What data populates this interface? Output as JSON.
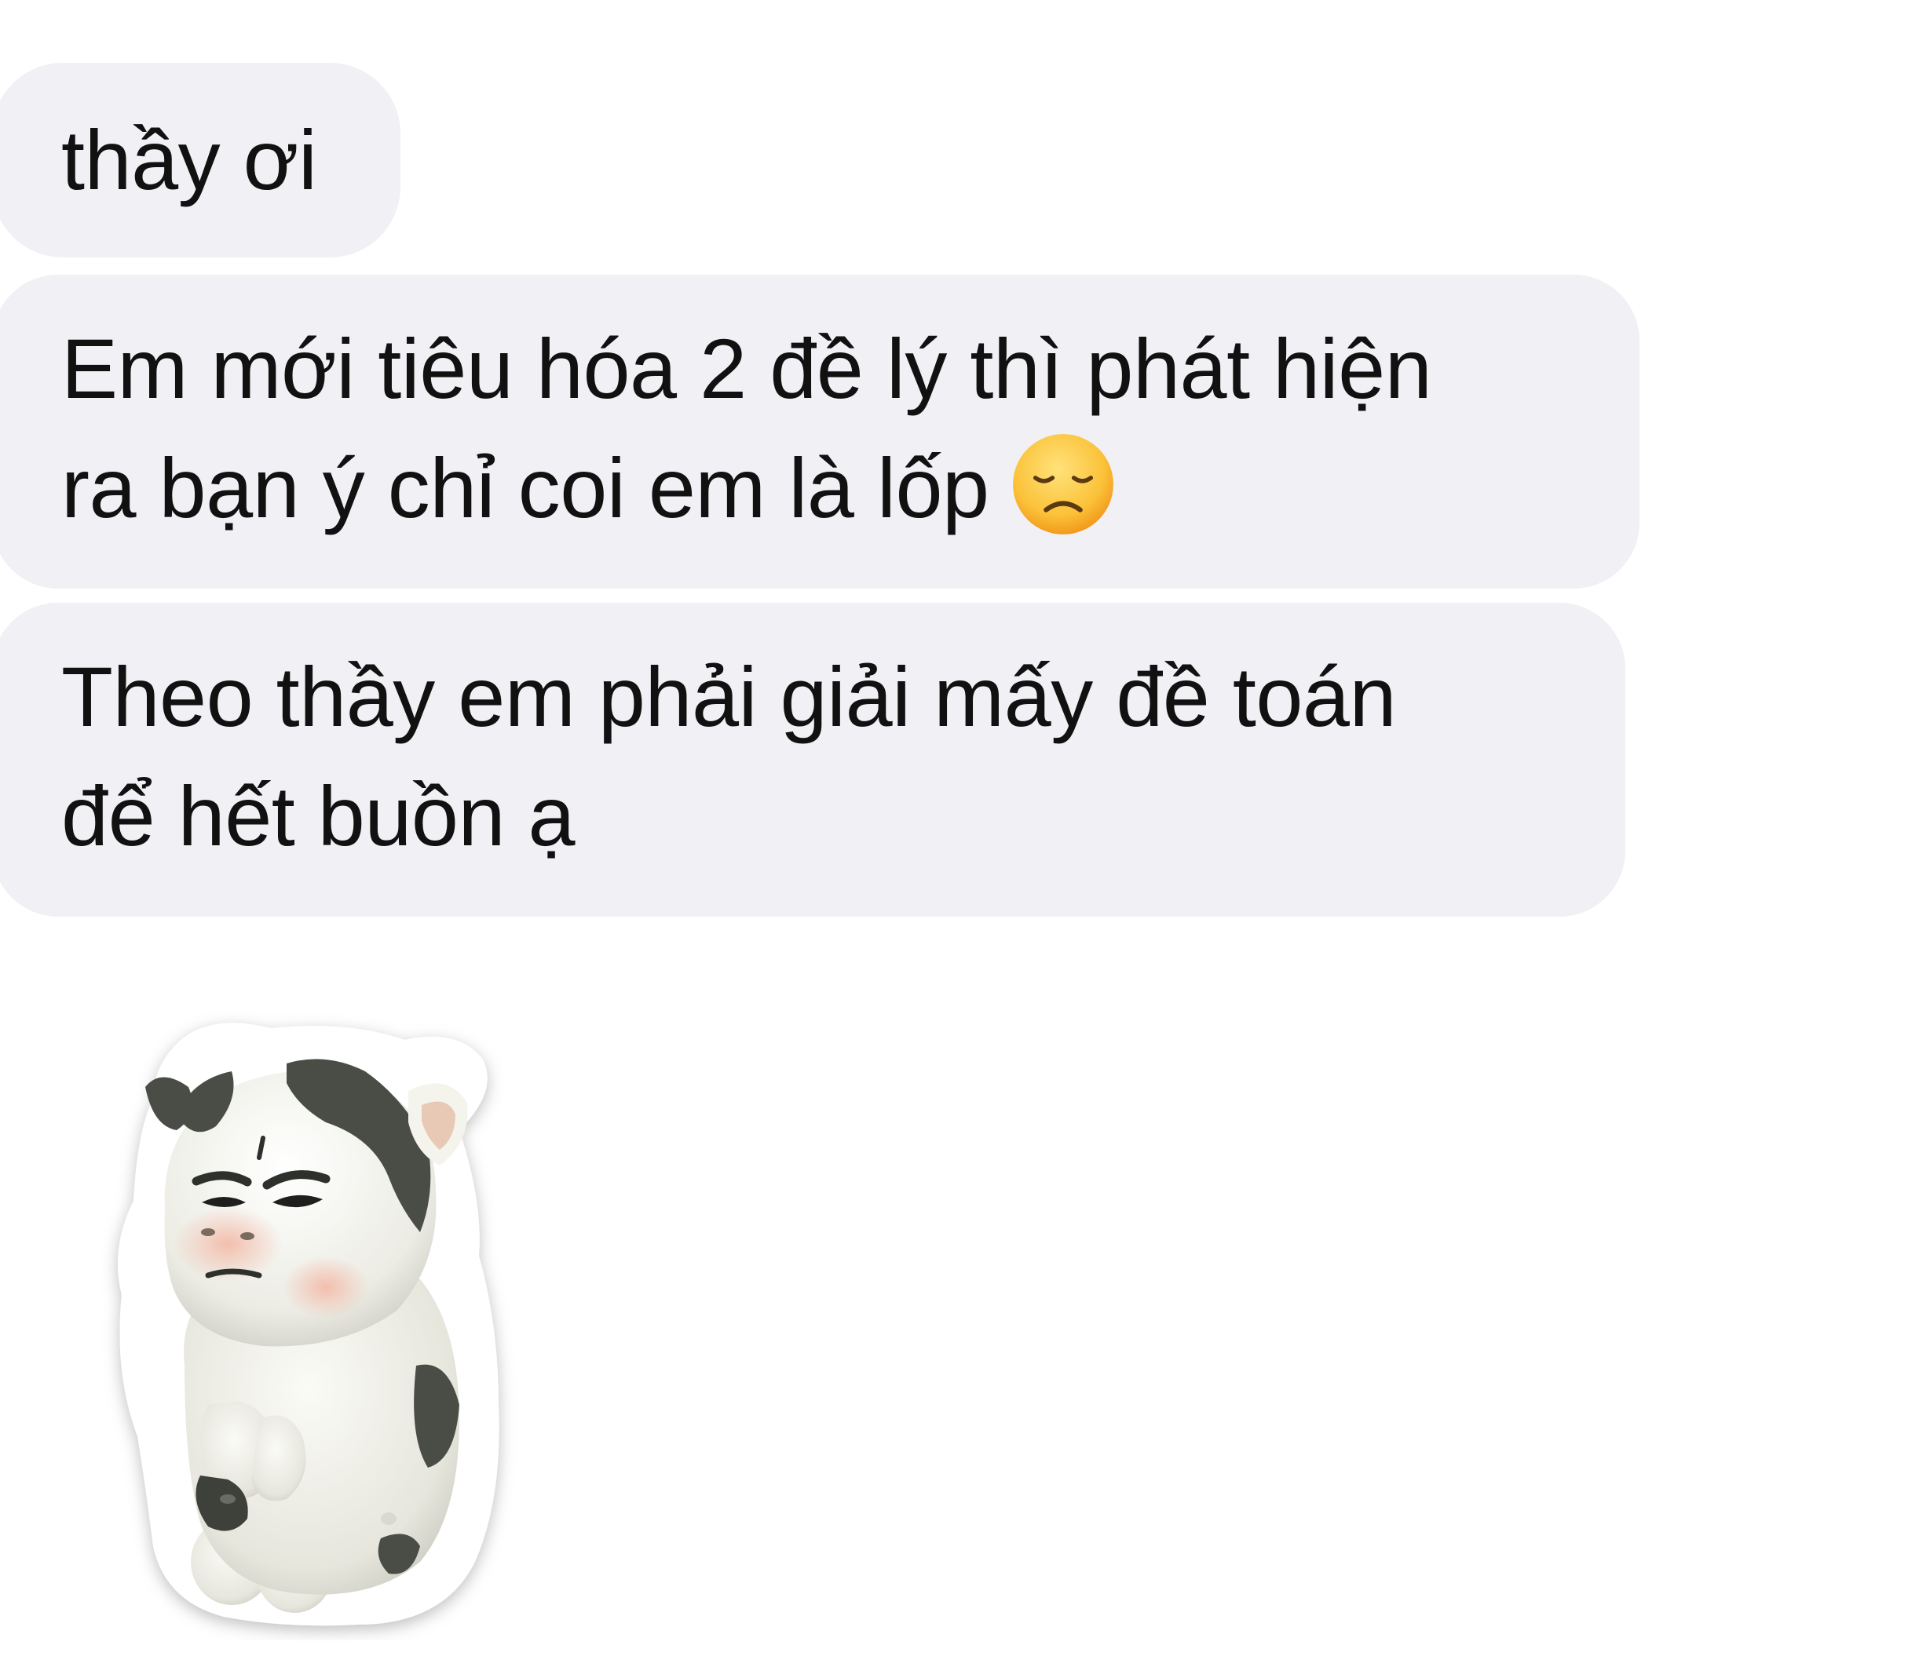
{
  "messages": [
    {
      "lines": [
        "thầy ơi"
      ]
    },
    {
      "lines": [
        "Em mới tiêu hóa 2 đề lý thì phát hiện",
        "ra bạn ý chỉ coi em là lốp"
      ],
      "emoji": "disappointed-face-icon"
    },
    {
      "lines": [
        "Theo thầy em phải giải mấy đề toán",
        "để hết buồn ạ"
      ]
    }
  ],
  "sticker": {
    "icon": "grumpy-cow-sticker"
  },
  "colors": {
    "bubble_bg": "#f0f0f5",
    "text": "#111111",
    "background": "#ffffff"
  }
}
